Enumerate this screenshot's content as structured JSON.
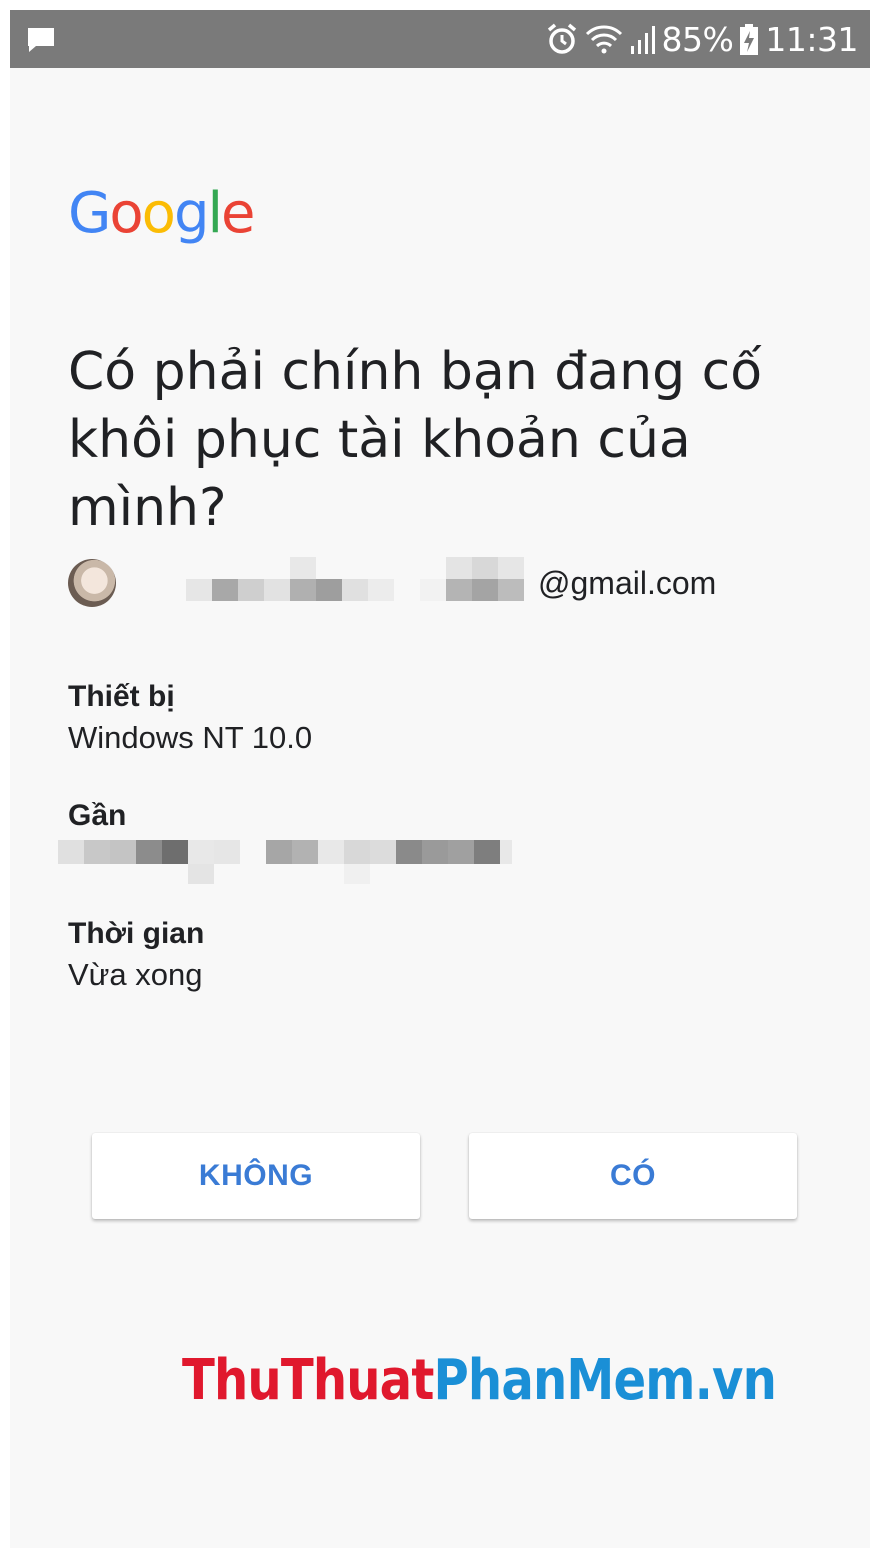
{
  "status_bar": {
    "battery_percent": "85%",
    "time": "11:31",
    "icons": [
      "message-icon",
      "alarm-icon",
      "wifi-icon",
      "signal-icon",
      "battery-charging-icon"
    ]
  },
  "logo": {
    "text": "Google",
    "letters": [
      {
        "char": "G",
        "color": "#4285f4"
      },
      {
        "char": "o",
        "color": "#ea4335"
      },
      {
        "char": "o",
        "color": "#fbbc05"
      },
      {
        "char": "g",
        "color": "#4285f4"
      },
      {
        "char": "l",
        "color": "#34a853"
      },
      {
        "char": "e",
        "color": "#ea4335"
      }
    ]
  },
  "headline": "Có phải chính bạn đang cố khôi phục tài khoản của mình?",
  "account": {
    "email_domain": "@gmail.com"
  },
  "details": [
    {
      "label": "Thiết bị",
      "value": "Windows NT 10.0"
    },
    {
      "label": "Gần",
      "value": ""
    },
    {
      "label": "Thời gian",
      "value": "Vừa xong"
    }
  ],
  "buttons": {
    "no_label": "KHÔNG",
    "yes_label": "CÓ"
  },
  "watermark": {
    "part1": "ThuThuat",
    "part2": "PhanMem.vn"
  },
  "colors": {
    "accent": "#3a7bd5",
    "status_bar": "#7a7a7a",
    "background": "#f8f8f8"
  }
}
